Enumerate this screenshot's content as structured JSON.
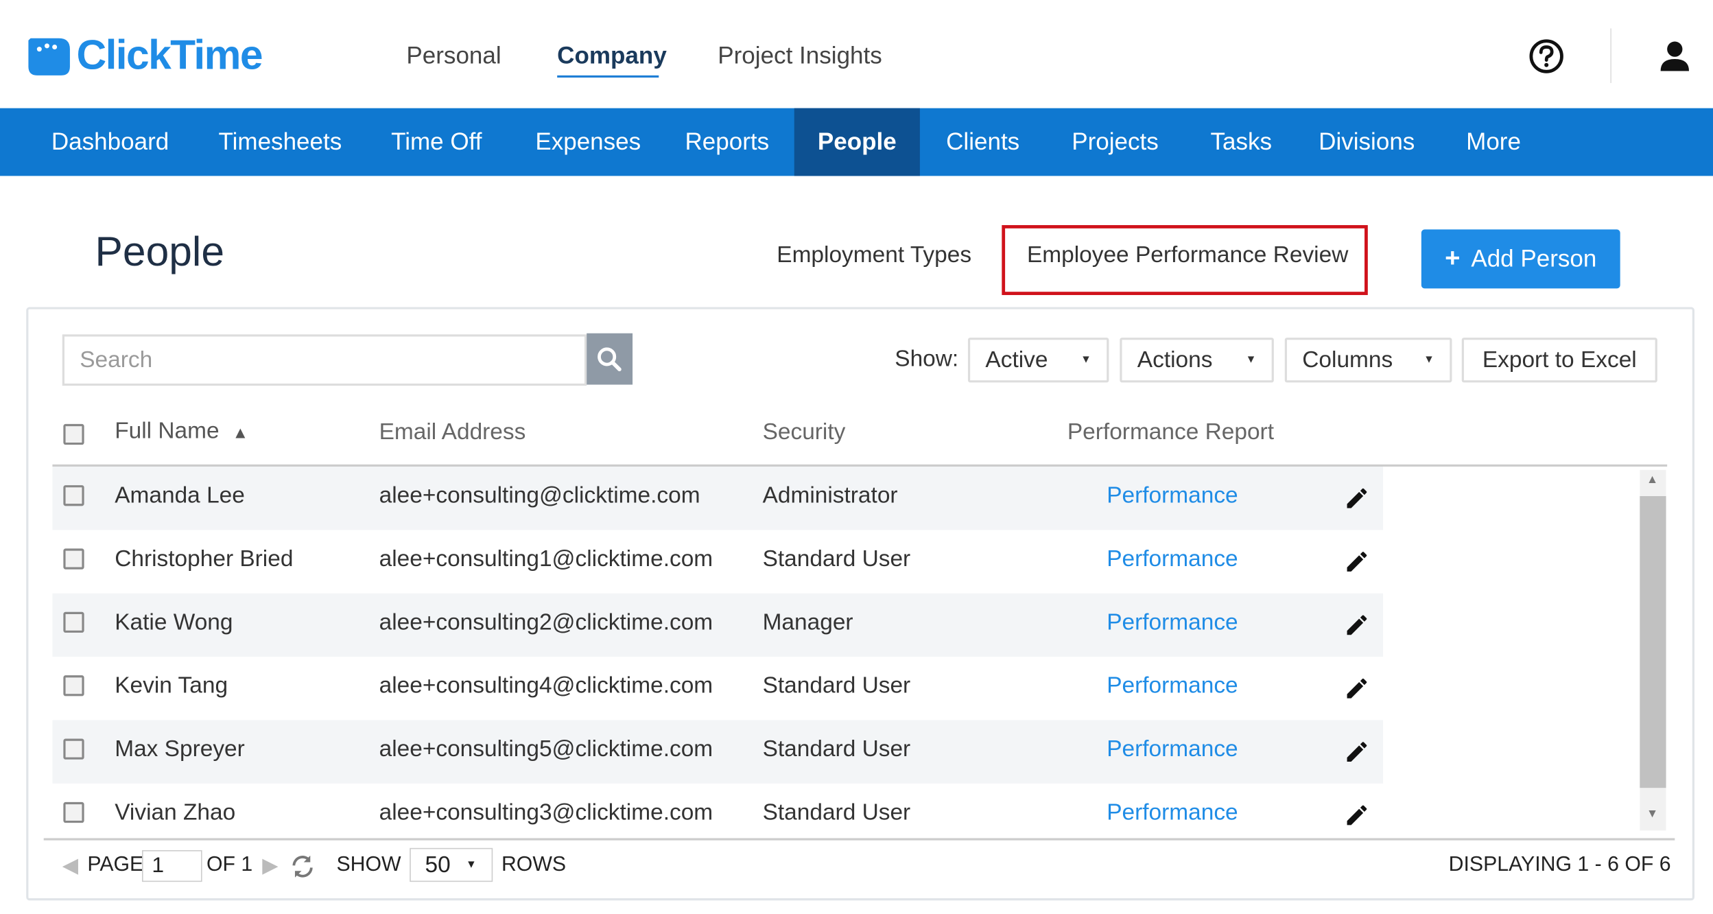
{
  "brand": {
    "name": "ClickTime"
  },
  "top_nav": [
    "Personal",
    "Company",
    "Project Insights"
  ],
  "top_nav_active": "Company",
  "main_nav": [
    "Dashboard",
    "Timesheets",
    "Time Off",
    "Expenses",
    "Reports",
    "People",
    "Clients",
    "Projects",
    "Tasks",
    "Divisions",
    "More"
  ],
  "main_nav_active": "People",
  "page": {
    "title": "People",
    "employment_types": "Employment Types",
    "performance_review": "Employee Performance Review",
    "add_person": "Add Person"
  },
  "toolbar": {
    "search_placeholder": "Search",
    "show_label": "Show:",
    "show_value": "Active",
    "actions": "Actions",
    "columns": "Columns",
    "export": "Export to Excel"
  },
  "table": {
    "headers": {
      "name": "Full Name",
      "email": "Email Address",
      "security": "Security",
      "report": "Performance Report"
    },
    "sort": "Full Name ascending",
    "rows": [
      {
        "name": "Amanda Lee",
        "email": "alee+consulting@clicktime.com",
        "security": "Administrator",
        "report": "Performance"
      },
      {
        "name": "Christopher Bried",
        "email": "alee+consulting1@clicktime.com",
        "security": "Standard User",
        "report": "Performance"
      },
      {
        "name": "Katie Wong",
        "email": "alee+consulting2@clicktime.com",
        "security": "Manager",
        "report": "Performance"
      },
      {
        "name": "Kevin Tang",
        "email": "alee+consulting4@clicktime.com",
        "security": "Standard User",
        "report": "Performance"
      },
      {
        "name": "Max Spreyer",
        "email": "alee+consulting5@clicktime.com",
        "security": "Standard User",
        "report": "Performance"
      },
      {
        "name": "Vivian Zhao",
        "email": "alee+consulting3@clicktime.com",
        "security": "Standard User",
        "report": "Performance"
      }
    ]
  },
  "pager": {
    "page_label": "PAGE",
    "page_value": "1",
    "of_label": "OF 1",
    "show_label": "SHOW",
    "rows_value": "50",
    "rows_label": "ROWS",
    "displaying": "DISPLAYING 1 - 6 OF 6"
  },
  "colors": {
    "brand_blue": "#1f8ce6",
    "nav_blue": "#0f78d0",
    "nav_active": "#0d5192",
    "highlight_red": "#d0121b"
  },
  "icons": [
    "clicktime-logo-icon",
    "help-icon",
    "user-icon",
    "search-icon",
    "sort-asc-icon",
    "edit-pencil-icon",
    "refresh-icon",
    "prev-page-icon",
    "next-page-icon"
  ]
}
